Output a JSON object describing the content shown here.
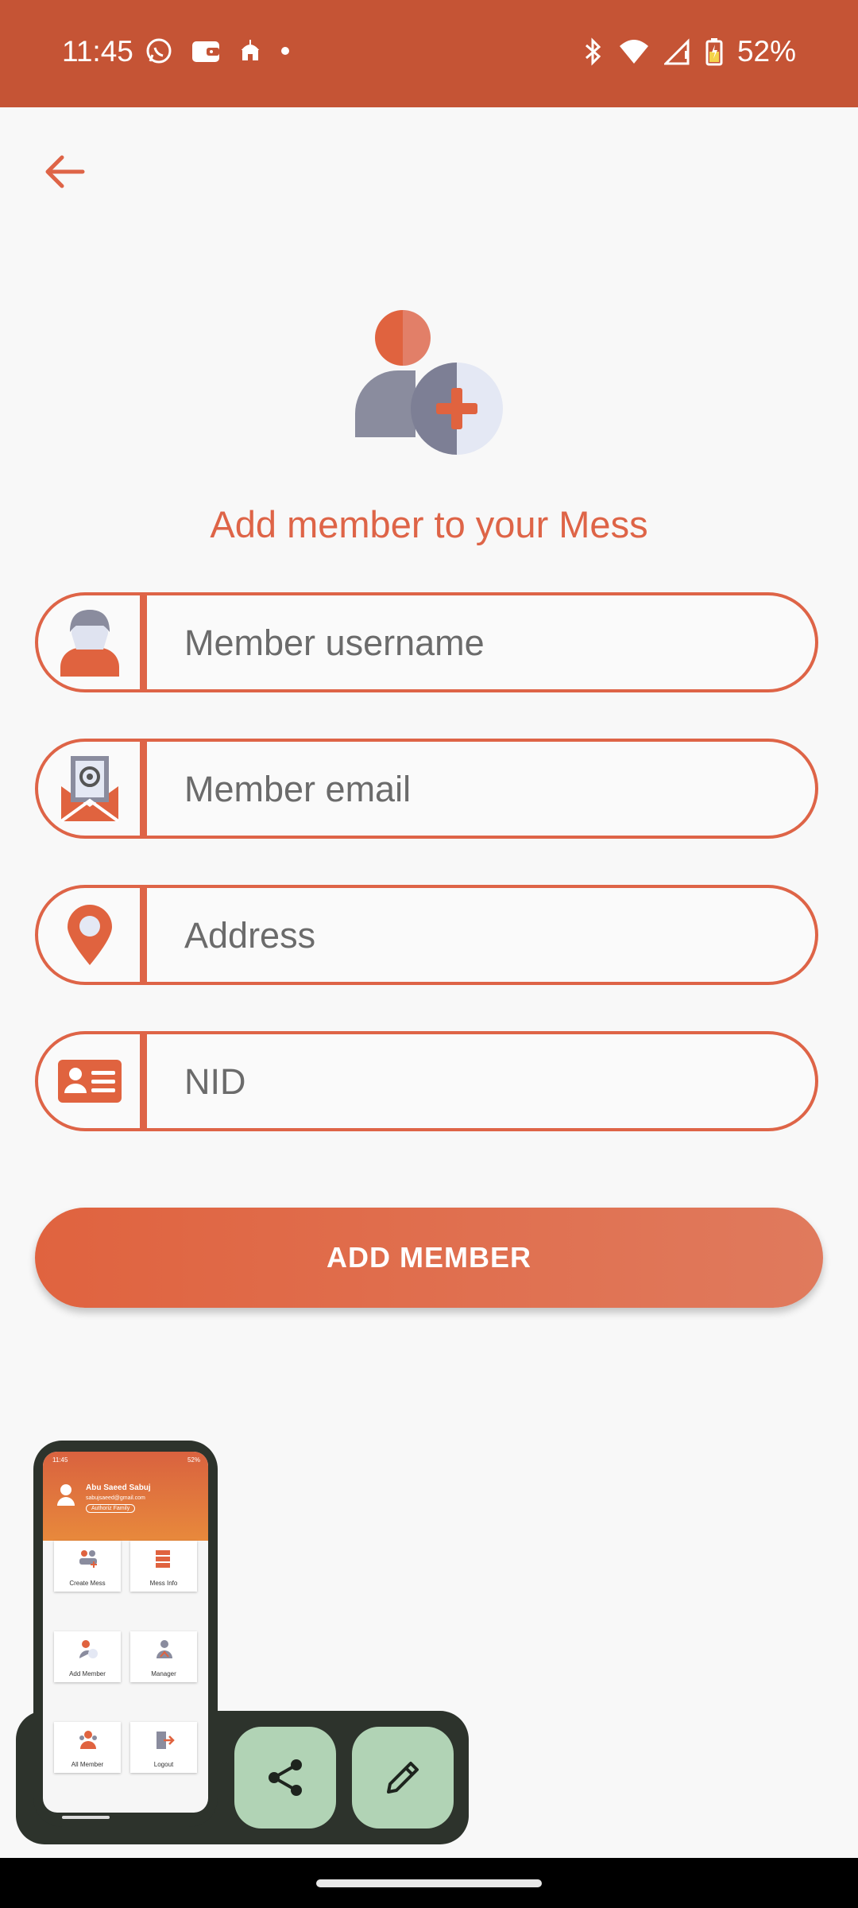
{
  "status_bar": {
    "time": "11:45",
    "battery": "52%",
    "left_icons": [
      "whatsapp-icon",
      "wallet-icon",
      "mosque-icon",
      "dot-icon"
    ],
    "right_icons": [
      "bluetooth-icon",
      "wifi-icon",
      "signal-icon",
      "battery-icon"
    ]
  },
  "header": {
    "back_icon": "arrow-left-icon"
  },
  "page": {
    "title": "Add member to your Mess"
  },
  "form": {
    "username": {
      "placeholder": "Member username",
      "value": ""
    },
    "email": {
      "placeholder": "Member email",
      "value": ""
    },
    "address": {
      "placeholder": "Address",
      "value": ""
    },
    "nid": {
      "placeholder": "NID",
      "value": ""
    },
    "submit_label": "ADD MEMBER"
  },
  "preview": {
    "status_time": "11:45",
    "status_battery": "52%",
    "user_name": "Abu Saeed Sabuj",
    "user_email": "sabujsaeed@gmail.com",
    "role": "Authoriz Family",
    "cards": [
      "Create Mess",
      "Mess Info",
      "Add Member",
      "Manager",
      "All Member",
      "Logout"
    ]
  },
  "floating_actions": {
    "share_icon": "share-icon",
    "edit_icon": "pencil-icon"
  },
  "colors": {
    "primary": "#de6447",
    "status_bar": "#c55435",
    "fab": "#b1d3b5",
    "fab_panel": "#2d332c"
  }
}
